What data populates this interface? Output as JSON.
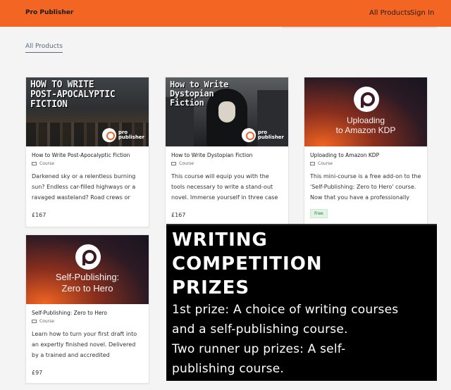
{
  "header": {
    "brand": "Pro Publisher",
    "nav": {
      "all_products": "All Products",
      "sign_in": "Sign In"
    },
    "accent_color": "#f26522"
  },
  "breadcrumb": "All Products",
  "cards": [
    {
      "thumb_title": "HOW TO WRITE\nPOST-APOCALYPTIC\nFICTION",
      "logo_text": "pro\npublisher",
      "title": "How to Write Post-Apocalyptic Fiction",
      "type": "Course",
      "description": "Darkened sky or a relentless burning sun? Endless car-filled highways or a ravaged wasteland? Road crews or cannibals? We...",
      "price": "£167"
    },
    {
      "thumb_title": "How to Write\nDystopian\nFiction",
      "logo_text": "pro\npublisher",
      "title": "How to Write Dystopian Fiction",
      "type": "Course",
      "description": "This course will equip you with the tools necessary to write a stand-out novel. Immerse yourself in three case studies,...",
      "price": "£167"
    },
    {
      "thumb_title": "Uploading\nto Amazon KDP",
      "title": "Uploading to Amazon KDP",
      "type": "Course",
      "description": "This mini-course is a free add-on to the 'Self-Publishing: Zero to Hero' course. Now that you have a professionally finished...",
      "badge": "Free"
    },
    {
      "thumb_title": "Self-Publishing:\nZero to Hero",
      "title": "Self-Publishing: Zero to Hero",
      "type": "Course",
      "description": "Learn how to turn your first draft into an expertly finished novel. Delivered by a trained and accredited professional edito...",
      "price": "£97"
    }
  ],
  "promo": {
    "heading_1": "WRITING",
    "heading_2": "COMPETITION",
    "heading_3": "PRIZES",
    "line_1": "1st prize: A choice of writing courses",
    "line_2": "and a self-publishing course.",
    "line_3": "Two runner up prizes: A self-",
    "line_4": "publishing course."
  },
  "icons": [
    "course-icon",
    "pro-publisher-logo"
  ]
}
